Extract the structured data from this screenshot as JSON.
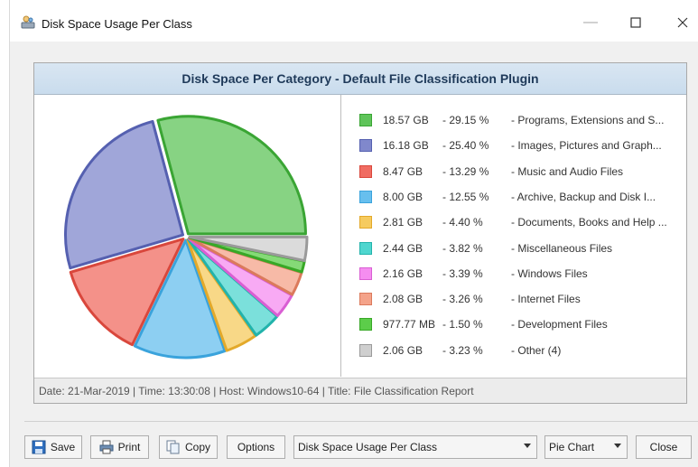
{
  "window": {
    "title": "Disk Space Usage Per Class"
  },
  "panel": {
    "header": "Disk Space Per Category - Default File Classification Plugin",
    "footer": "Date: 21-Mar-2019 | Time: 13:30:08 | Host: Windows10-64 | Title: File Classification Report"
  },
  "chart_data": {
    "type": "pie",
    "title": "Disk Space Per Category - Default File Classification Plugin",
    "slices": [
      {
        "size": "18.57 GB",
        "percent_label": "- 29.15 %",
        "label": "- Programs, Extensions and S...",
        "value": 29.15,
        "color": "#5fc45a",
        "border": "#3aa534"
      },
      {
        "size": "16.18 GB",
        "percent_label": "- 25.40 %",
        "label": "- Images, Pictures and Graph...",
        "value": 25.4,
        "color": "#8088cc",
        "border": "#5560b0"
      },
      {
        "size": "8.47 GB",
        "percent_label": "- 13.29 %",
        "label": "- Music and Audio Files",
        "value": 13.29,
        "color": "#f06c62",
        "border": "#d9473c"
      },
      {
        "size": "8.00 GB",
        "percent_label": "- 12.55 %",
        "label": "- Archive, Backup and Disk I...",
        "value": 12.55,
        "color": "#67bfee",
        "border": "#3aa3dc"
      },
      {
        "size": "2.81 GB",
        "percent_label": "- 4.40 %",
        "label": "- Documents, Books and Help ...",
        "value": 4.4,
        "color": "#f6cb5f",
        "border": "#e3a92a"
      },
      {
        "size": "2.44 GB",
        "percent_label": "- 3.82 %",
        "label": "- Miscellaneous Files",
        "value": 3.82,
        "color": "#4fd6cf",
        "border": "#22b3ab"
      },
      {
        "size": "2.16 GB",
        "percent_label": "- 3.39 %",
        "label": "- Windows Files",
        "value": 3.39,
        "color": "#f58df0",
        "border": "#d95ed3"
      },
      {
        "size": "2.08 GB",
        "percent_label": "- 3.26 %",
        "label": "- Internet Files",
        "value": 3.26,
        "color": "#f4a38a",
        "border": "#db7a5c"
      },
      {
        "size": "977.77 MB",
        "percent_label": "- 1.50 %",
        "label": "- Development Files",
        "value": 1.5,
        "color": "#5ccd4a",
        "border": "#38a827"
      },
      {
        "size": "2.06 GB",
        "percent_label": "- 3.23 %",
        "label": "- Other (4)",
        "value": 3.23,
        "color": "#cfcfcf",
        "border": "#9a9a9a"
      }
    ]
  },
  "toolbar": {
    "save": "Save",
    "print": "Print",
    "copy": "Copy",
    "options": "Options",
    "report_select": "Disk Space Usage Per Class",
    "chart_select": "Pie Chart",
    "close": "Close"
  },
  "icons": {
    "app": "disk-space-app-icon",
    "save": "floppy-disk-icon",
    "print": "printer-icon",
    "copy": "copy-icon"
  }
}
